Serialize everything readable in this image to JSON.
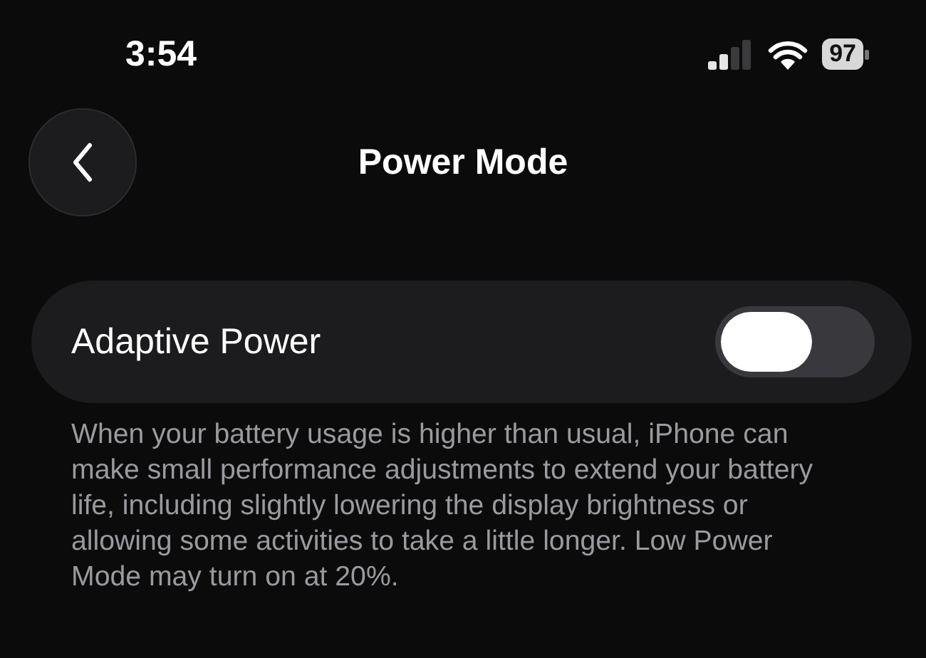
{
  "status_bar": {
    "time": "3:54",
    "battery": "97"
  },
  "nav": {
    "title": "Power Mode"
  },
  "settings": [
    {
      "kind": "toggle",
      "label": "Adaptive Power",
      "on": false
    }
  ],
  "description": "When your battery usage is higher than usual, iPhone can make small performance adjustments to extend your battery life, including slightly lowering the display brightness or allowing some activities to take a little longer. Low Power Mode may turn on at 20%."
}
